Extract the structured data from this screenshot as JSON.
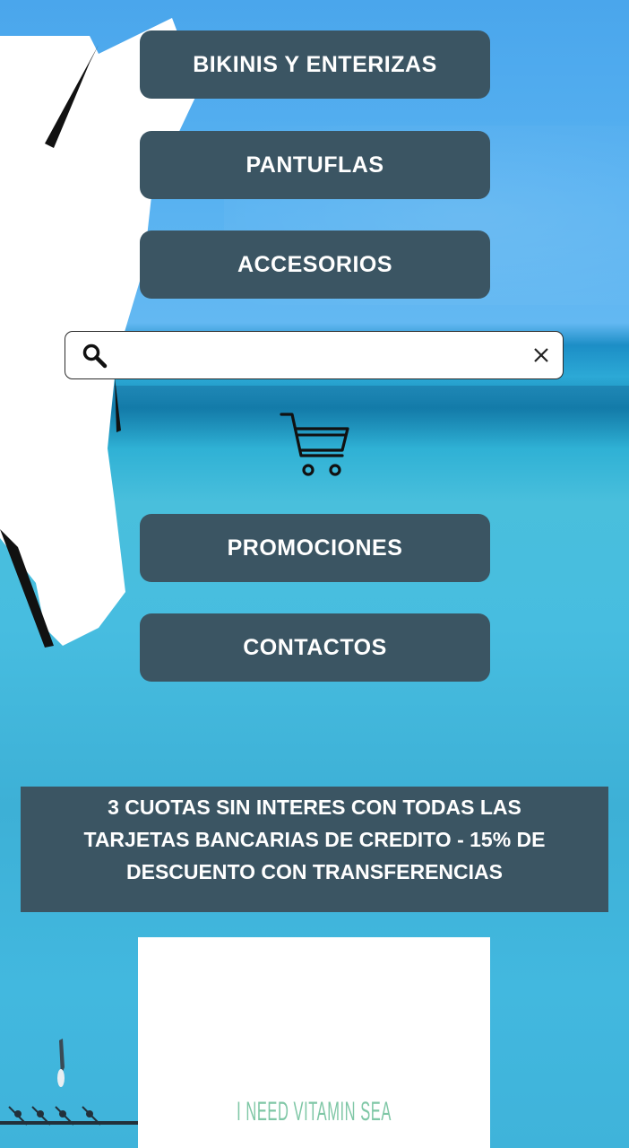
{
  "nav": {
    "bikinis_label": "BIKINIS Y ENTERIZAS",
    "pantuflas_label": "PANTUFLAS",
    "accesorios_label": "ACCESORIOS",
    "promociones_label": "PROMOCIONES",
    "contactos_label": "CONTACTOS"
  },
  "search": {
    "value": "",
    "icons": {
      "search": "search-icon",
      "clear": "close-icon"
    }
  },
  "cart": {
    "icon": "shopping-cart-icon"
  },
  "banner": {
    "text": "3 CUOTAS SIN INTERES CON TODAS LAS TARJETAS BANCARIAS DE CREDITO - 15% DE DESCUENTO CON TRANSFERENCIAS"
  },
  "promo_card": {
    "text": "I NEED VITAMIN SEA"
  },
  "colors": {
    "button_bg": "#3b5563",
    "button_text": "#ffffff",
    "accent_text": "#7fc7a6",
    "sea": "#42b8df",
    "sky": "#58b2f1"
  }
}
